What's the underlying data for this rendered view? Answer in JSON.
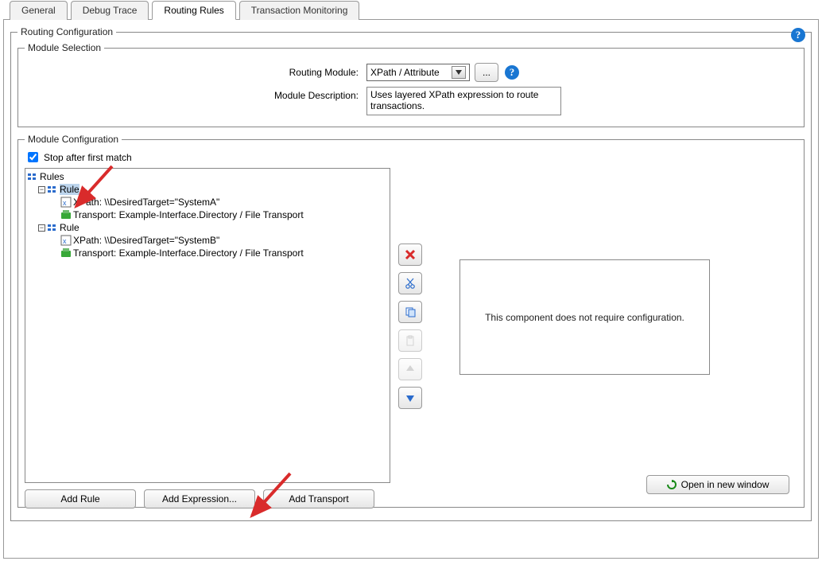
{
  "tabs": {
    "general": "General",
    "debug": "Debug Trace",
    "routing": "Routing Rules",
    "monitoring": "Transaction Monitoring"
  },
  "legends": {
    "routing_config": "Routing Configuration",
    "module_selection": "Module Selection",
    "module_config": "Module Configuration"
  },
  "module": {
    "label_module": "Routing Module:",
    "label_desc": "Module Description:",
    "selected": "XPath / Attribute",
    "browse": "...",
    "description": "Uses layered XPath expression to route transactions."
  },
  "stop_after": {
    "label": "Stop after first match",
    "checked": true
  },
  "tree": {
    "root": "Rules",
    "rule1": {
      "label": "Rule",
      "xpath": "XPath: \\\\DesiredTarget=\"SystemA\"",
      "transport": "Transport: Example-Interface.Directory / File Transport"
    },
    "rule2": {
      "label": "Rule",
      "xpath": "XPath: \\\\DesiredTarget=\"SystemB\"",
      "transport": "Transport: Example-Interface.Directory / File Transport"
    }
  },
  "config_placeholder": "This component does not require configuration.",
  "buttons": {
    "add_rule": "Add Rule",
    "add_expr": "Add Expression...",
    "add_transport": "Add Transport",
    "open_new": "Open in new window"
  },
  "side_buttons": {
    "delete": "delete",
    "cut": "cut",
    "copy": "copy",
    "paste": "paste",
    "move_up": "move-up",
    "move_down": "move-down"
  },
  "colors": {
    "arrow": "#d92b2b",
    "help": "#1976d2"
  }
}
